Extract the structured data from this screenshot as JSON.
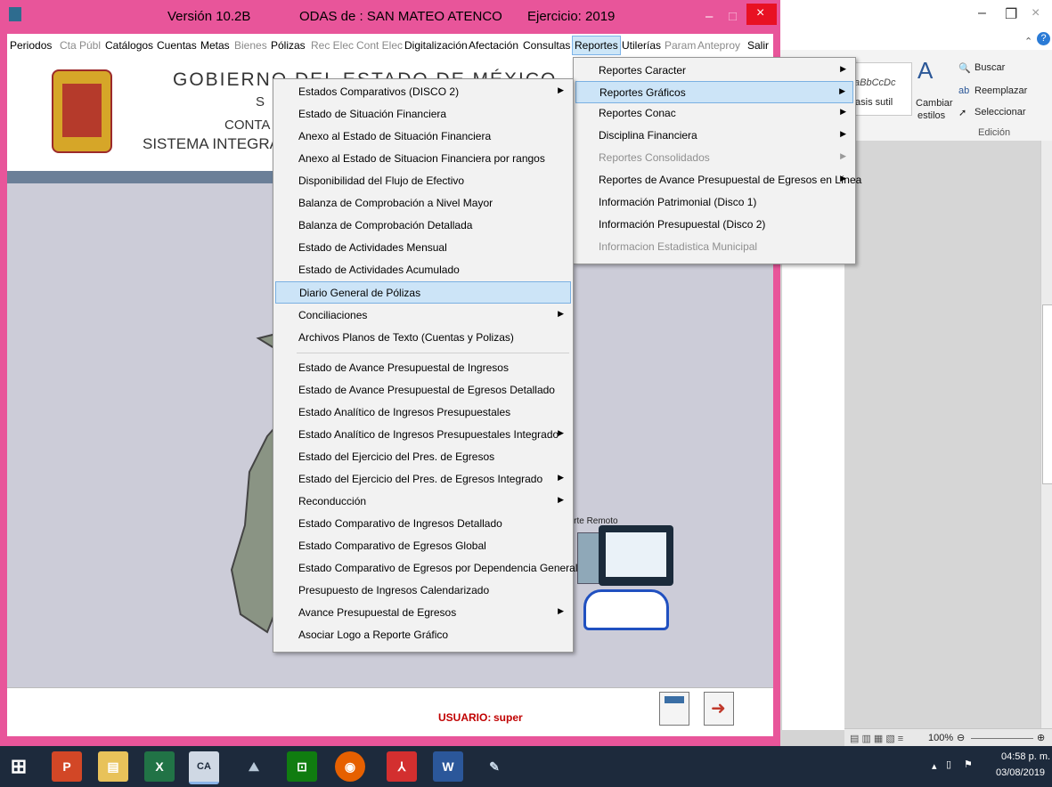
{
  "odas_window": {
    "version": "Versión 10.2B",
    "title": "ODAS de : SAN MATEO ATENCO",
    "exercise": "Ejercicio: 2019",
    "close_symbol": "×",
    "min_symbol": "–",
    "max_symbol": "□"
  },
  "menubar": [
    {
      "label": "Periodos",
      "enabled": true
    },
    {
      "label": "Cta Públ",
      "enabled": false
    },
    {
      "label": "Catálogos",
      "enabled": true
    },
    {
      "label": "Cuentas",
      "enabled": true
    },
    {
      "label": "Metas",
      "enabled": true
    },
    {
      "label": "Bienes",
      "enabled": false
    },
    {
      "label": "Pólizas",
      "enabled": true
    },
    {
      "label": "Rec Elec",
      "enabled": false
    },
    {
      "label": "Cont Elec",
      "enabled": false
    },
    {
      "label": "Digitalización",
      "enabled": true
    },
    {
      "label": "Afectación",
      "enabled": true
    },
    {
      "label": "Consultas",
      "enabled": true
    },
    {
      "label": "Reportes",
      "enabled": true
    },
    {
      "label": "Utilerías",
      "enabled": true
    },
    {
      "label": "Param",
      "enabled": false
    },
    {
      "label": "Anteproy",
      "enabled": false
    },
    {
      "label": "Salir",
      "enabled": true
    }
  ],
  "banner": {
    "line1": "GOBIERNO DEL ESTADO DE MÉXICO",
    "line2": "S",
    "line3": "CONTA",
    "line4": "SISTEMA INTEGRA"
  },
  "remote_caption": "porte Remoto",
  "user": {
    "label": "USUARIO:",
    "name": "super"
  },
  "reportes_menu": [
    {
      "label": "Reportes Caracter",
      "submenu": true,
      "enabled": true
    },
    {
      "label": "Reportes Gráficos",
      "submenu": true,
      "enabled": true,
      "highlighted": true
    },
    {
      "label": "Reportes Conac",
      "submenu": true,
      "enabled": true
    },
    {
      "label": "Disciplina Financiera",
      "submenu": true,
      "enabled": true
    },
    {
      "label": "Reportes Consolidados",
      "submenu": true,
      "enabled": false
    },
    {
      "label": "Reportes de Avance Presupuestal de Egresos en Línea",
      "submenu": true,
      "enabled": true
    },
    {
      "label": "Información Patrimonial (Disco 1)",
      "submenu": false,
      "enabled": true
    },
    {
      "label": "Información Presupuestal (Disco 2)",
      "submenu": false,
      "enabled": true
    },
    {
      "label": "Informacion Estadistica Municipal",
      "submenu": false,
      "enabled": false
    }
  ],
  "graficos_menu": [
    {
      "label": "Estados Comparativos (DISCO 2)",
      "submenu": true
    },
    {
      "label": "Estado de Situación Financiera",
      "submenu": false
    },
    {
      "label": "Anexo al Estado de Situación Financiera",
      "submenu": false
    },
    {
      "label": "Anexo al Estado de Situacion Financiera por rangos",
      "submenu": false
    },
    {
      "label": "Disponibilidad del Flujo de Efectivo",
      "submenu": false
    },
    {
      "label": "Balanza de Comprobación a Nivel Mayor",
      "submenu": false
    },
    {
      "label": "Balanza de Comprobación Detallada",
      "submenu": false
    },
    {
      "label": "Estado de Actividades Mensual",
      "submenu": false
    },
    {
      "label": "Estado de Actividades Acumulado",
      "submenu": false
    },
    {
      "label": "Diario General de Pólizas",
      "submenu": false,
      "highlighted": true
    },
    {
      "label": "Conciliaciones",
      "submenu": true
    },
    {
      "label": "Archivos Planos de Texto (Cuentas y Polizas)",
      "submenu": false,
      "separator_after": true
    },
    {
      "label": "Estado de Avance Presupuestal de Ingresos",
      "submenu": false
    },
    {
      "label": "Estado de Avance Presupuestal de Egresos Detallado",
      "submenu": false
    },
    {
      "label": "Estado Analítico de Ingresos Presupuestales",
      "submenu": false
    },
    {
      "label": "Estado Analítico de Ingresos Presupuestales Integrado",
      "submenu": true
    },
    {
      "label": "Estado del Ejercicio del Pres. de Egresos",
      "submenu": false
    },
    {
      "label": "Estado del Ejercicio del Pres. de Egresos Integrado",
      "submenu": true
    },
    {
      "label": "Reconducción",
      "submenu": true
    },
    {
      "label": "Estado Comparativo de Ingresos Detallado",
      "submenu": false
    },
    {
      "label": "Estado Comparativo de Egresos Global",
      "submenu": false
    },
    {
      "label": "Estado Comparativo de Egresos por Dependencia General",
      "submenu": false
    },
    {
      "label": "Presupuesto de Ingresos Calendarizado",
      "submenu": false
    },
    {
      "label": "Avance Presupuestal de Egresos",
      "submenu": true
    },
    {
      "label": "Asociar Logo a Reporte Gráfico",
      "submenu": false
    }
  ],
  "word_ribbon": {
    "style_preview": "aBbCcDc",
    "style_name": "fasis sutil",
    "change_styles_1": "Cambiar",
    "change_styles_2": "estilos",
    "buscar": "Buscar",
    "reemplazar": "Reemplazar",
    "seleccionar": "Seleccionar",
    "edicion": "Edición",
    "zoom": "100%"
  },
  "taskbar": {
    "apps": [
      "start",
      "powerpoint",
      "explorer",
      "excel",
      "cal",
      "photos",
      "store",
      "firefox",
      "acrobat",
      "word",
      "paint"
    ],
    "clock_time": "04:58 p. m.",
    "clock_date": "03/08/2019"
  },
  "colors": {
    "odas_frame": "#e8559a",
    "taskbar": "#1d2a3c",
    "menu_highlight": "#cce4f7"
  }
}
